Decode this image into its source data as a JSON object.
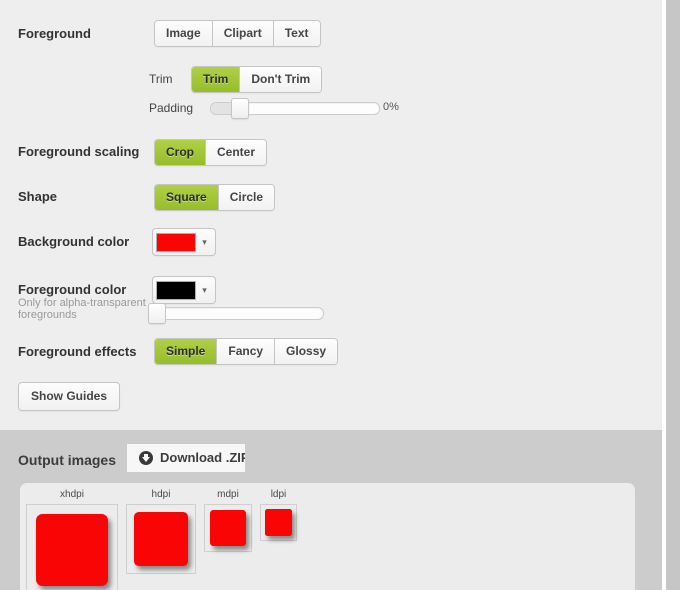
{
  "settings": {
    "rows": [
      {
        "label": "Foreground",
        "options": [
          "Image",
          "Clipart",
          "Text"
        ],
        "selected": ""
      },
      {
        "label": "Foreground scaling",
        "options": [
          "Crop",
          "Center"
        ],
        "selected": "Crop"
      },
      {
        "label": "Shape",
        "options": [
          "Square",
          "Circle"
        ],
        "selected": "Square"
      },
      {
        "label": "Background color",
        "swatch_color": "#fa0505"
      },
      {
        "label": "Foreground color",
        "sublabel": "Only for alpha-transparent foregrounds",
        "swatch_color": "#000000"
      },
      {
        "label": "Foreground effects",
        "options": [
          "Simple",
          "Fancy",
          "Glossy"
        ],
        "selected": "Simple"
      }
    ],
    "trim": {
      "label": "Trim",
      "options": [
        "Trim",
        "Don't Trim"
      ],
      "selected": "Trim"
    },
    "padding": {
      "label": "Padding",
      "value_text": "0%"
    },
    "show_guides_label": "Show Guides",
    "caret_glyph": "▾",
    "accent_green": "#a5c63b"
  },
  "output": {
    "title": "Output images",
    "download_label": "Download .ZIP",
    "items": [
      {
        "dpi": "xhdpi",
        "cell": 90,
        "art": 72
      },
      {
        "dpi": "hdpi",
        "cell": 68,
        "art": 54
      },
      {
        "dpi": "mdpi",
        "cell": 46,
        "art": 36
      },
      {
        "dpi": "ldpi",
        "cell": 35,
        "art": 27
      }
    ]
  }
}
